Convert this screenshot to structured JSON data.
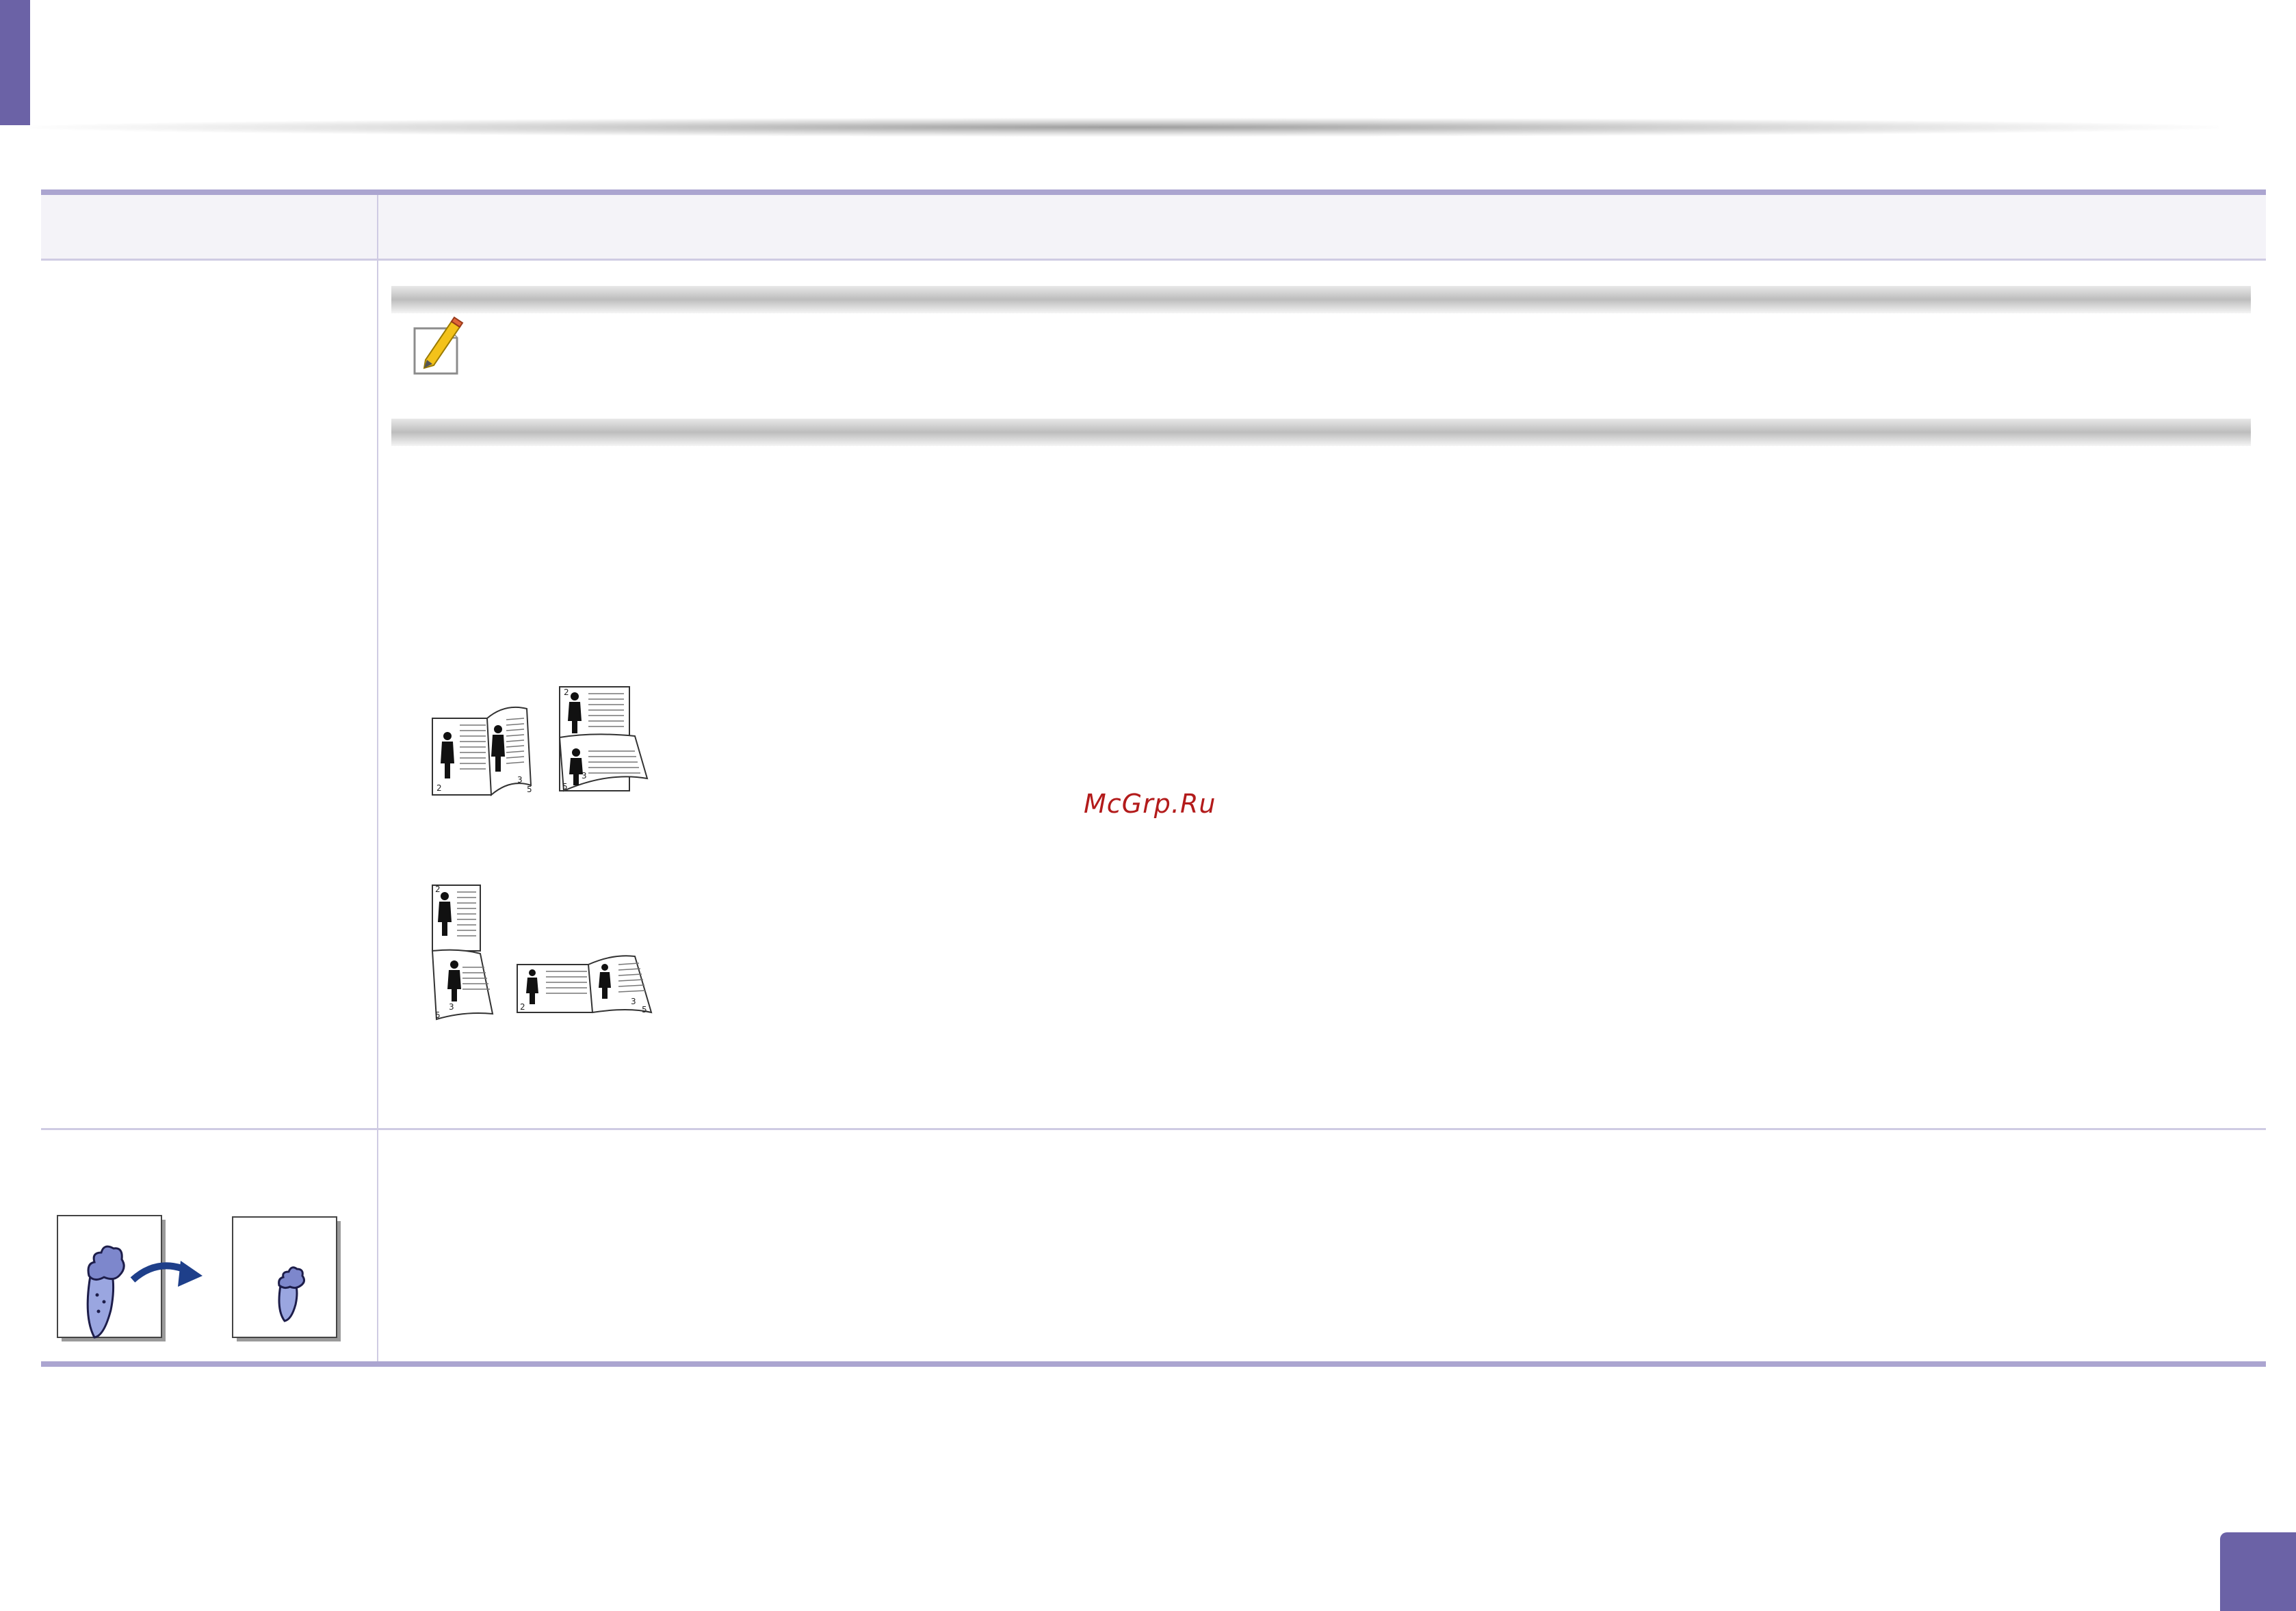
{
  "watermark": {
    "text": "McGrp.Ru"
  },
  "colors": {
    "accent": "#6b62a6",
    "table_rule": "#aba5d0",
    "table_header_bg": "#f4f3f8",
    "watermark": "#b31b1b"
  },
  "icons": {
    "note": "note-pencil-icon",
    "booklet_long_edge": "booklet-long-edge-binding-icon",
    "booklet_short_edge": "booklet-short-edge-binding-icon",
    "reduce_enlarge": "reduce-enlarge-icon"
  },
  "figures": {
    "long_edge_page_numbers": [
      "2",
      "3",
      "5",
      "2",
      "3",
      "5"
    ],
    "short_edge_page_numbers": [
      "2",
      "3",
      "5",
      "2",
      "3",
      "5"
    ]
  }
}
